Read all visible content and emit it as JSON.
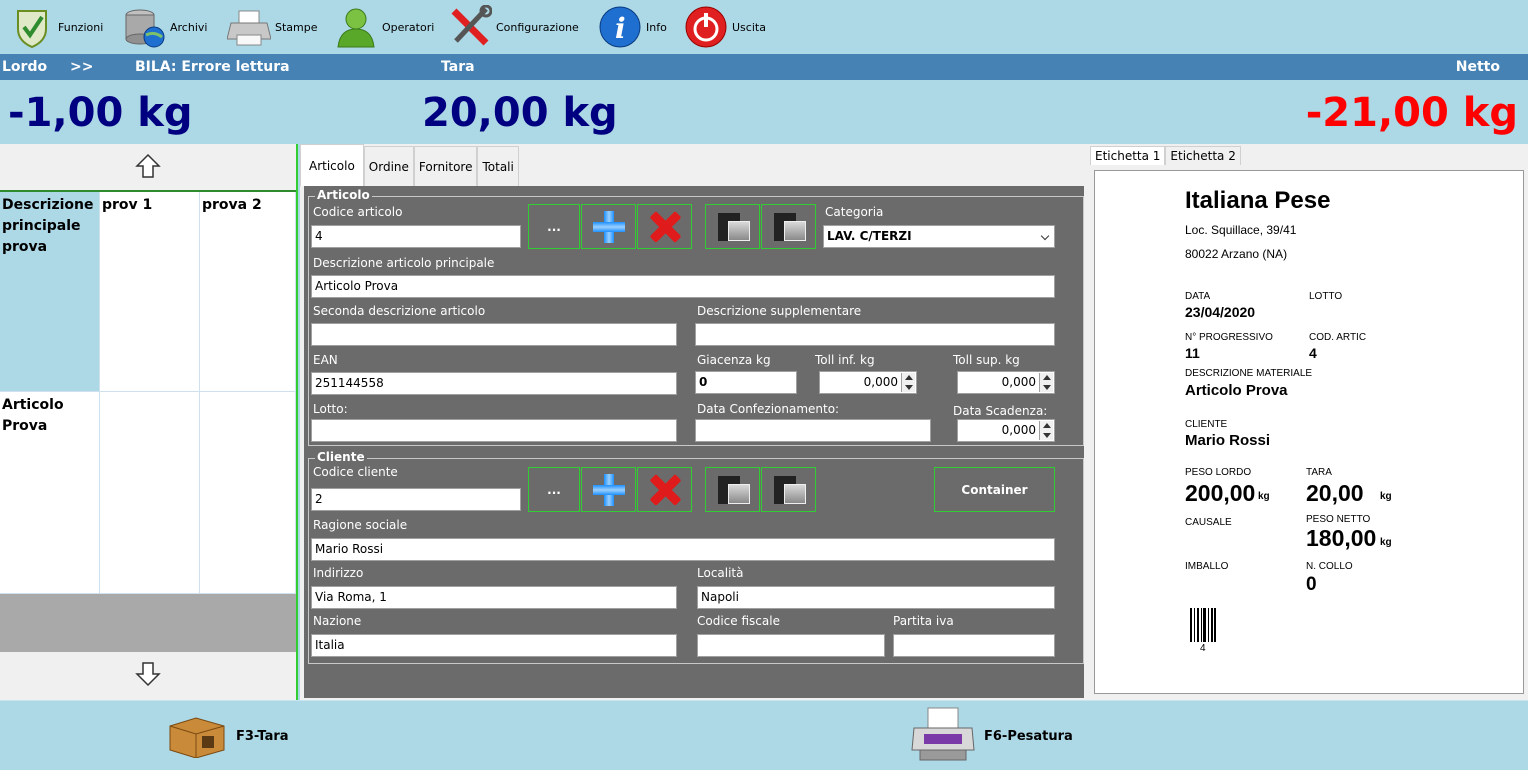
{
  "toolbar": {
    "items": [
      {
        "label": "Funzioni",
        "icon": "checkmark-shield-icon"
      },
      {
        "label": "Archivi",
        "icon": "database-globe-icon"
      },
      {
        "label": "Stampe",
        "icon": "printer-icon"
      },
      {
        "label": "Operatori",
        "icon": "user-icon"
      },
      {
        "label": "Configurazione",
        "icon": "tools-icon"
      },
      {
        "label": "Info",
        "icon": "info-icon"
      },
      {
        "label": "Uscita",
        "icon": "power-icon"
      }
    ]
  },
  "header": {
    "lordo_label": "Lordo",
    "arrows": ">>",
    "status": "BILA: Errore lettura",
    "tara_label": "Tara",
    "netto_label": "Netto"
  },
  "weights": {
    "lordo": "-1,00 kg",
    "tara": "20,00 kg",
    "netto": "-21,00 kg",
    "lordo_color": "#000080",
    "tara_color": "#000080",
    "netto_color": "#ff0000"
  },
  "left_grid": {
    "headers": [
      "Descrizione principale prova",
      "prov 1",
      "prova 2"
    ],
    "rows": [
      [
        "Articolo Prova",
        "",
        ""
      ]
    ]
  },
  "center": {
    "tabs": [
      "Articolo",
      "Ordine",
      "Fornitore",
      "Totali"
    ],
    "articolo": {
      "title": "Articolo",
      "codice_label": "Codice articolo",
      "codice_value": "4",
      "lookup_label": "...",
      "categoria_label": "Categoria",
      "categoria_value": "LAV. C/TERZI",
      "desc_principale_label": "Descrizione articolo principale",
      "desc_principale_value": "Articolo Prova",
      "seconda_desc_label": "Seconda descrizione articolo",
      "seconda_desc_value": "",
      "desc_supp_label": "Descrizione supplementare",
      "desc_supp_value": "",
      "ean_label": "EAN",
      "ean_value": "251144558",
      "giacenza_label": "Giacenza kg",
      "giacenza_value": "0",
      "toll_inf_label": "Toll inf. kg",
      "toll_inf_value": "0,000",
      "toll_sup_label": "Toll sup. kg",
      "toll_sup_value": "0,000",
      "lotto_label": "Lotto:",
      "lotto_value": "",
      "data_conf_label": "Data Confezionamento:",
      "data_conf_value": "",
      "data_scad_label": "Data Scadenza:",
      "data_scad_value": "0,000"
    },
    "cliente": {
      "title": "Cliente",
      "codice_label": "Codice cliente",
      "codice_value": "2",
      "lookup_label": "...",
      "container_label": "Container",
      "ragione_label": "Ragione sociale",
      "ragione_value": "Mario Rossi",
      "indirizzo_label": "Indirizzo",
      "indirizzo_value": "Via Roma, 1",
      "localita_label": "Località",
      "localita_value": "Napoli",
      "nazione_label": "Nazione",
      "nazione_value": "Italia",
      "cf_label": "Codice fiscale",
      "cf_value": "",
      "piva_label": "Partita iva",
      "piva_value": ""
    }
  },
  "right": {
    "tabs": [
      "Etichetta 1",
      "Etichetta 2"
    ],
    "label": {
      "company": "Italiana Pese",
      "address1": "Loc. Squillace, 39/41",
      "address2": "80022 Arzano (NA)",
      "data_label": "DATA",
      "data_value": "23/04/2020",
      "lotto_label": "LOTTO",
      "progressivo_label": "N° PROGRESSIVO",
      "progressivo_value": "11",
      "cod_artic_label": "COD. ARTIC",
      "cod_artic_value": "4",
      "desc_mat_label": "DESCRIZIONE MATERIALE",
      "desc_mat_value": "Articolo Prova",
      "cliente_label": "CLIENTE",
      "cliente_value": "Mario Rossi",
      "peso_lordo_label": "PESO LORDO",
      "peso_lordo_value": "200,00",
      "tara_label": "TARA",
      "tara_value": "20,00",
      "kg": "kg",
      "causale_label": "CAUSALE",
      "peso_netto_label": "PESO NETTO",
      "peso_netto_value": "180,00",
      "imballo_label": "IMBALLO",
      "n_collo_label": "N. COLLO",
      "n_collo_value": "0",
      "barcode_text": "4"
    }
  },
  "bottom": {
    "tara_btn": "F3-Tara",
    "pesatura_btn": "F6-Pesatura"
  }
}
